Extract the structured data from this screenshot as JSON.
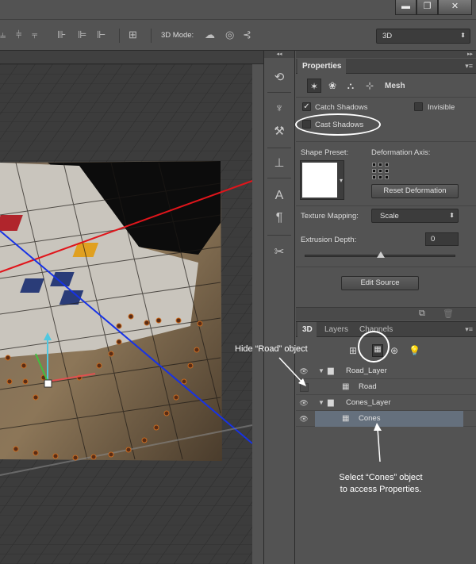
{
  "window": {
    "minimize": "▬",
    "restore": "❐",
    "close": "✕"
  },
  "options_bar": {
    "mode_label": "3D Mode:",
    "workspace_select": "3D",
    "icons": [
      "align-top-icon",
      "align-vcenter-icon",
      "align-bottom-icon",
      "align-left-icon",
      "align-hcenter-icon",
      "align-right-icon",
      "distribute-icon",
      "orbit-icon",
      "roll-icon",
      "pan-icon"
    ]
  },
  "toolbar": {
    "collapse": "◂◂",
    "tools": [
      "history-icon",
      "brush-presets-icon",
      "tool-presets-icon",
      "stamp-icon",
      "character-icon",
      "paragraph-icon",
      "tools-icon"
    ]
  },
  "properties": {
    "collapse": "▸▸",
    "tab": "Properties",
    "menu": "▾≡",
    "section_title": "Mesh",
    "catch_shadows": {
      "label": "Catch Shadows",
      "checked": "✓"
    },
    "invisible": {
      "label": "Invisible"
    },
    "cast_shadows": {
      "label": "Cast Shadows"
    },
    "shape_preset_label": "Shape Preset:",
    "deformation_axis_label": "Deformation Axis:",
    "reset_deformation": "Reset Deformation",
    "texture_mapping_label": "Texture Mapping:",
    "texture_mapping_value": "Scale",
    "extrusion_depth_label": "Extrusion Depth:",
    "extrusion_depth_value": "0",
    "edit_source": "Edit Source"
  },
  "layers_panel": {
    "tabs": [
      "3D",
      "Layers",
      "Channels"
    ],
    "menu": "▾≡",
    "rows": [
      {
        "name": "Road_Layer",
        "type": "group"
      },
      {
        "name": "Road",
        "type": "mesh"
      },
      {
        "name": "Cones_Layer",
        "type": "group"
      },
      {
        "name": "Cones",
        "type": "mesh"
      }
    ]
  },
  "annotations": {
    "hide_road": "Hide “Road” object",
    "select_cones_line1": "Select “Cones” object",
    "select_cones_line2": "to access Properties."
  },
  "colors": {
    "panel_bg": "#535353",
    "selected_row": "#65707d",
    "grid_red": "#e0151b",
    "grid_blue": "#1632e6"
  }
}
